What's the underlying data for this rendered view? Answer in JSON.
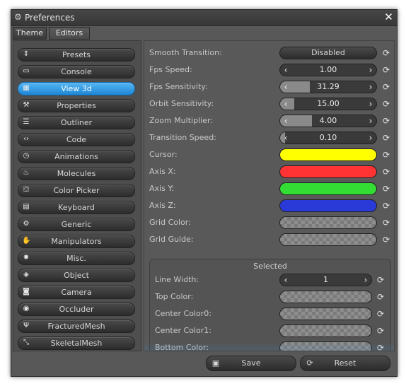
{
  "window": {
    "title": "Preferences",
    "icon": "gear-icon",
    "close_icon": "close-icon"
  },
  "tabs": [
    {
      "label": "Theme"
    },
    {
      "label": "Editors"
    }
  ],
  "sidebar": {
    "items": [
      {
        "label": "Presets",
        "icon": "updown-arrows-icon"
      },
      {
        "label": "Console",
        "icon": "terminal-icon"
      },
      {
        "label": "View 3d",
        "icon": "grid-icon",
        "active": true
      },
      {
        "label": "Properties",
        "icon": "wrench-icon"
      },
      {
        "label": "Outliner",
        "icon": "list-icon"
      },
      {
        "label": "Code",
        "icon": "code-icon"
      },
      {
        "label": "Animations",
        "icon": "clock-icon"
      },
      {
        "label": "Molecules",
        "icon": "flame-icon"
      },
      {
        "label": "Color Picker",
        "icon": "paint-bucket-icon"
      },
      {
        "label": "Keyboard",
        "icon": "keyboard-icon"
      },
      {
        "label": "Generic",
        "icon": "gears-icon"
      },
      {
        "label": "Manipulators",
        "icon": "hand-icon"
      },
      {
        "label": "Misc.",
        "icon": "star-icon"
      },
      {
        "label": "Object",
        "icon": "cube-icon"
      },
      {
        "label": "Camera",
        "icon": "camera-icon"
      },
      {
        "label": "Occluder",
        "icon": "eye-icon"
      },
      {
        "label": "FracturedMesh",
        "icon": "fractured-icon"
      },
      {
        "label": "SkeletalMesh",
        "icon": "skeleton-icon"
      }
    ]
  },
  "settings": [
    {
      "label": "Smooth Transition:",
      "type": "button",
      "value": "Disabled"
    },
    {
      "label": "Fps Speed:",
      "type": "number",
      "value": "1.00",
      "fill": 0.0
    },
    {
      "label": "Fps Sensitivity:",
      "type": "number",
      "value": "31.29",
      "fill": 0.31
    },
    {
      "label": "Orbit Sensitivity:",
      "type": "number",
      "value": "15.00",
      "fill": 0.15
    },
    {
      "label": "Zoom Multiplier:",
      "type": "number",
      "value": "4.00",
      "fill": 0.33
    },
    {
      "label": "Transition Speed:",
      "type": "number",
      "value": "0.10",
      "fill": 0.05
    },
    {
      "label": "Cursor:",
      "type": "color",
      "color": "#ffff00"
    },
    {
      "label": "Axis X:",
      "type": "color",
      "color": "#ff3333"
    },
    {
      "label": "Axis Y:",
      "type": "color",
      "color": "#33dd33"
    },
    {
      "label": "Axis Z:",
      "type": "color",
      "color": "#2a3ad8"
    },
    {
      "label": "Grid Color:",
      "type": "transparent"
    },
    {
      "label": "Grid Guide:",
      "type": "transparent"
    }
  ],
  "selected_group": {
    "title": "Selected",
    "rows": [
      {
        "label": "Line Width:",
        "type": "number",
        "value": "1",
        "fill": 0.0
      },
      {
        "label": "Top Color:",
        "type": "transparent"
      },
      {
        "label": "Center Color0:",
        "type": "transparent"
      },
      {
        "label": "Center Color1:",
        "type": "transparent"
      },
      {
        "label": "Bottom Color:",
        "type": "transparent"
      }
    ]
  },
  "footer": {
    "save_label": "Save",
    "save_icon": "floppy-icon",
    "reset_label": "Reset",
    "reset_icon": "refresh-icon"
  }
}
